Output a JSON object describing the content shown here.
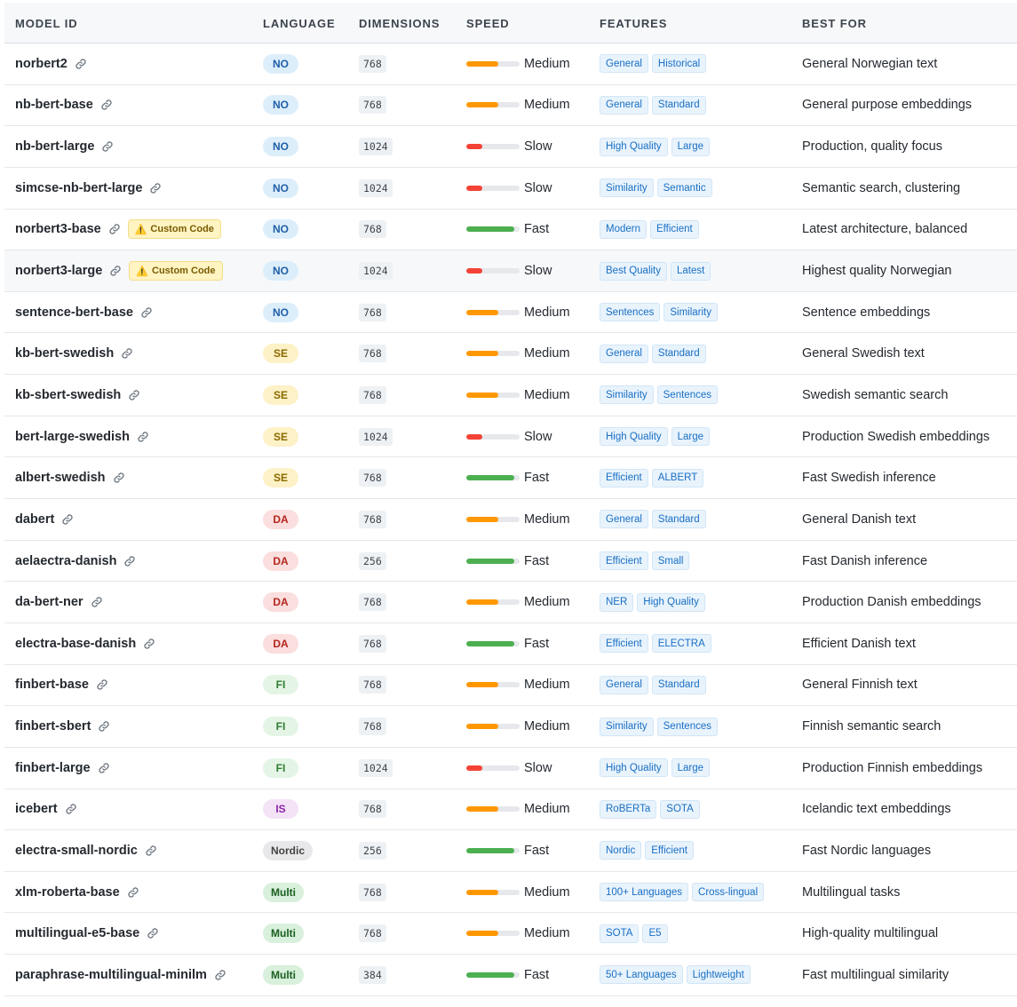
{
  "headers": {
    "model_id": "MODEL ID",
    "language": "LANGUAGE",
    "dimensions": "DIMENSIONS",
    "speed": "SPEED",
    "features": "FEATURES",
    "best_for": "BEST FOR"
  },
  "link_icon": "link-icon",
  "warning_icon": "warning-icon",
  "warning_glyph": "⚠️",
  "colors": {
    "speed_fast": "#4caf50",
    "speed_medium": "#ff9800",
    "speed_slow": "#f44336",
    "lang_no": {
      "bg": "#ddeefb",
      "fg": "#1f5fa8"
    },
    "lang_se": {
      "bg": "#fdf1c7",
      "fg": "#8a6a00"
    },
    "lang_da": {
      "bg": "#fbdede",
      "fg": "#b3261e"
    },
    "lang_fi": {
      "bg": "#e4f5e6",
      "fg": "#2e7d32"
    },
    "lang_is": {
      "bg": "#f4e3f7",
      "fg": "#8e24aa"
    },
    "lang_nordic": {
      "bg": "#e8e8ea",
      "fg": "#444444"
    },
    "lang_multi": {
      "bg": "#d8f0dc",
      "fg": "#1b5e20"
    }
  },
  "rows": [
    {
      "model": "norbert2",
      "lang": "NO",
      "lang_key": "lang_no",
      "dim": "768",
      "speed": "Medium",
      "speed_level": 0.6,
      "features": [
        "General",
        "Historical"
      ],
      "best_for": "General Norwegian text"
    },
    {
      "model": "nb-bert-base",
      "lang": "NO",
      "lang_key": "lang_no",
      "dim": "768",
      "speed": "Medium",
      "speed_level": 0.6,
      "features": [
        "General",
        "Standard"
      ],
      "best_for": "General purpose embeddings"
    },
    {
      "model": "nb-bert-large",
      "lang": "NO",
      "lang_key": "lang_no",
      "dim": "1024",
      "speed": "Slow",
      "speed_level": 0.3,
      "features": [
        "High Quality",
        "Large"
      ],
      "best_for": "Production, quality focus"
    },
    {
      "model": "simcse-nb-bert-large",
      "lang": "NO",
      "lang_key": "lang_no",
      "dim": "1024",
      "speed": "Slow",
      "speed_level": 0.3,
      "features": [
        "Similarity",
        "Semantic"
      ],
      "best_for": "Semantic search, clustering"
    },
    {
      "model": "norbert3-base",
      "custom": "Custom Code",
      "lang": "NO",
      "lang_key": "lang_no",
      "dim": "768",
      "speed": "Fast",
      "speed_level": 0.9,
      "features": [
        "Modern",
        "Efficient"
      ],
      "best_for": "Latest architecture, balanced"
    },
    {
      "model": "norbert3-large",
      "custom": "Custom Code",
      "highlight": true,
      "lang": "NO",
      "lang_key": "lang_no",
      "dim": "1024",
      "speed": "Slow",
      "speed_level": 0.3,
      "features": [
        "Best Quality",
        "Latest"
      ],
      "best_for": "Highest quality Norwegian"
    },
    {
      "model": "sentence-bert-base",
      "lang": "NO",
      "lang_key": "lang_no",
      "dim": "768",
      "speed": "Medium",
      "speed_level": 0.6,
      "features": [
        "Sentences",
        "Similarity"
      ],
      "best_for": "Sentence embeddings"
    },
    {
      "model": "kb-bert-swedish",
      "lang": "SE",
      "lang_key": "lang_se",
      "dim": "768",
      "speed": "Medium",
      "speed_level": 0.6,
      "features": [
        "General",
        "Standard"
      ],
      "best_for": "General Swedish text"
    },
    {
      "model": "kb-sbert-swedish",
      "lang": "SE",
      "lang_key": "lang_se",
      "dim": "768",
      "speed": "Medium",
      "speed_level": 0.6,
      "features": [
        "Similarity",
        "Sentences"
      ],
      "best_for": "Swedish semantic search"
    },
    {
      "model": "bert-large-swedish",
      "lang": "SE",
      "lang_key": "lang_se",
      "dim": "1024",
      "speed": "Slow",
      "speed_level": 0.3,
      "features": [
        "High Quality",
        "Large"
      ],
      "best_for": "Production Swedish embeddings"
    },
    {
      "model": "albert-swedish",
      "lang": "SE",
      "lang_key": "lang_se",
      "dim": "768",
      "speed": "Fast",
      "speed_level": 0.9,
      "features": [
        "Efficient",
        "ALBERT"
      ],
      "best_for": "Fast Swedish inference"
    },
    {
      "model": "dabert",
      "lang": "DA",
      "lang_key": "lang_da",
      "dim": "768",
      "speed": "Medium",
      "speed_level": 0.6,
      "features": [
        "General",
        "Standard"
      ],
      "best_for": "General Danish text"
    },
    {
      "model": "aelaectra-danish",
      "lang": "DA",
      "lang_key": "lang_da",
      "dim": "256",
      "speed": "Fast",
      "speed_level": 0.9,
      "features": [
        "Efficient",
        "Small"
      ],
      "best_for": "Fast Danish inference"
    },
    {
      "model": "da-bert-ner",
      "lang": "DA",
      "lang_key": "lang_da",
      "dim": "768",
      "speed": "Medium",
      "speed_level": 0.6,
      "features": [
        "NER",
        "High Quality"
      ],
      "best_for": "Production Danish embeddings"
    },
    {
      "model": "electra-base-danish",
      "lang": "DA",
      "lang_key": "lang_da",
      "dim": "768",
      "speed": "Fast",
      "speed_level": 0.9,
      "features": [
        "Efficient",
        "ELECTRA"
      ],
      "best_for": "Efficient Danish text"
    },
    {
      "model": "finbert-base",
      "lang": "FI",
      "lang_key": "lang_fi",
      "dim": "768",
      "speed": "Medium",
      "speed_level": 0.6,
      "features": [
        "General",
        "Standard"
      ],
      "best_for": "General Finnish text"
    },
    {
      "model": "finbert-sbert",
      "lang": "FI",
      "lang_key": "lang_fi",
      "dim": "768",
      "speed": "Medium",
      "speed_level": 0.6,
      "features": [
        "Similarity",
        "Sentences"
      ],
      "best_for": "Finnish semantic search"
    },
    {
      "model": "finbert-large",
      "lang": "FI",
      "lang_key": "lang_fi",
      "dim": "1024",
      "speed": "Slow",
      "speed_level": 0.3,
      "features": [
        "High Quality",
        "Large"
      ],
      "best_for": "Production Finnish embeddings"
    },
    {
      "model": "icebert",
      "lang": "IS",
      "lang_key": "lang_is",
      "dim": "768",
      "speed": "Medium",
      "speed_level": 0.6,
      "features": [
        "RoBERTa",
        "SOTA"
      ],
      "best_for": "Icelandic text embeddings"
    },
    {
      "model": "electra-small-nordic",
      "lang": "Nordic",
      "lang_key": "lang_nordic",
      "dim": "256",
      "speed": "Fast",
      "speed_level": 0.9,
      "features": [
        "Nordic",
        "Efficient"
      ],
      "best_for": "Fast Nordic languages"
    },
    {
      "model": "xlm-roberta-base",
      "lang": "Multi",
      "lang_key": "lang_multi",
      "dim": "768",
      "speed": "Medium",
      "speed_level": 0.6,
      "features": [
        "100+ Languages",
        "Cross-lingual"
      ],
      "best_for": "Multilingual tasks"
    },
    {
      "model": "multilingual-e5-base",
      "lang": "Multi",
      "lang_key": "lang_multi",
      "dim": "768",
      "speed": "Medium",
      "speed_level": 0.6,
      "features": [
        "SOTA",
        "E5"
      ],
      "best_for": "High-quality multilingual"
    },
    {
      "model": "paraphrase-multilingual-minilm",
      "lang": "Multi",
      "lang_key": "lang_multi",
      "dim": "384",
      "speed": "Fast",
      "speed_level": 0.9,
      "features": [
        "50+ Languages",
        "Lightweight"
      ],
      "best_for": "Fast multilingual similarity"
    }
  ]
}
